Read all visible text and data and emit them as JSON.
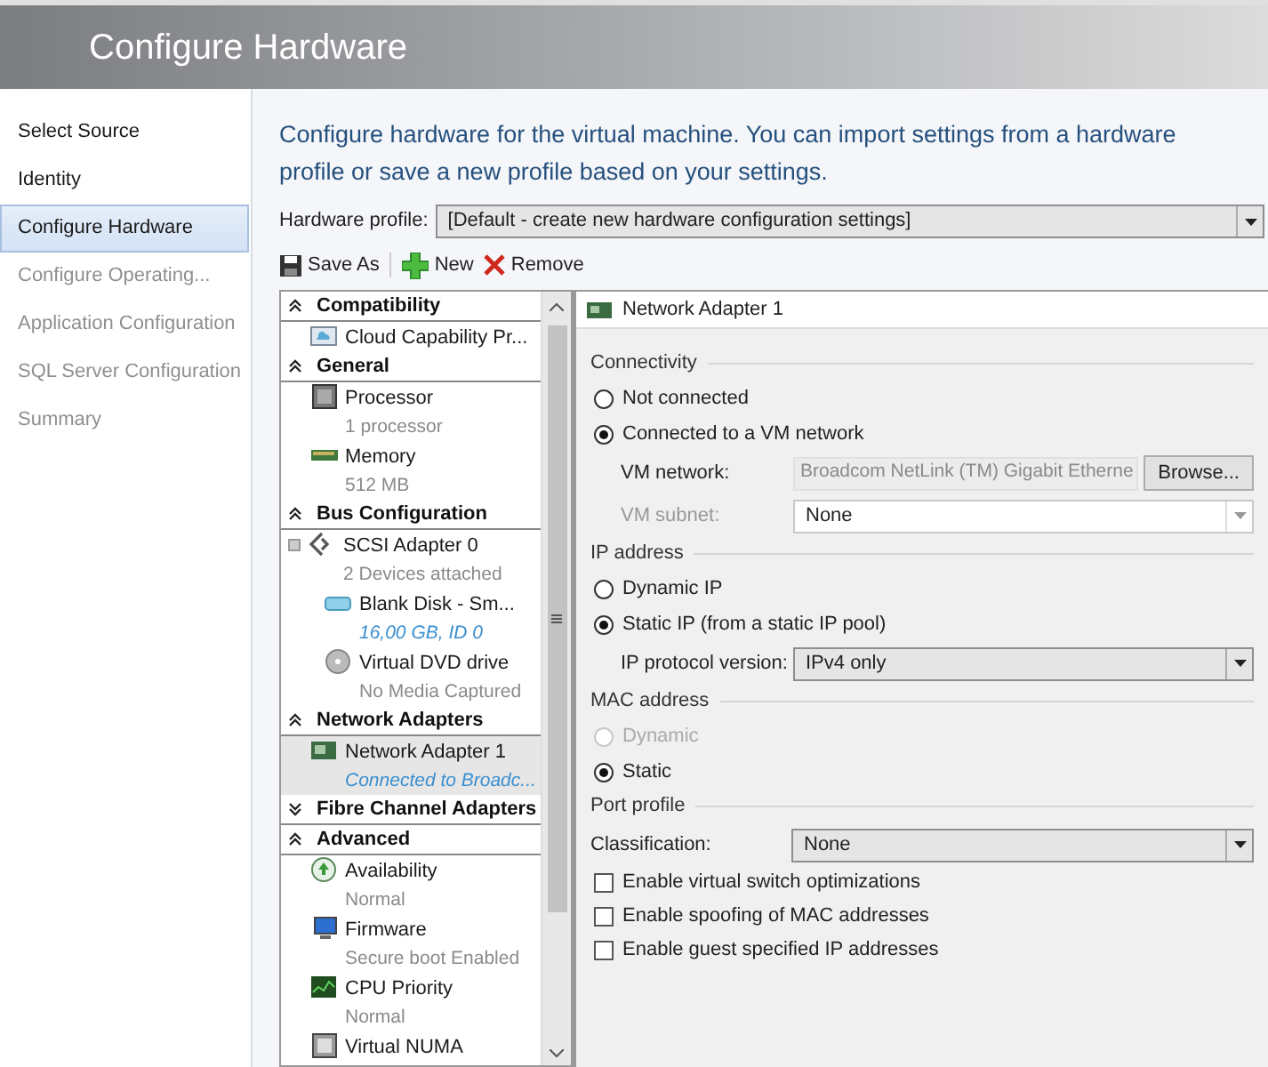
{
  "header": {
    "title": "Configure Hardware"
  },
  "sidebar": {
    "items": [
      {
        "label": "Select Source",
        "selected": false,
        "disabled": false
      },
      {
        "label": "Identity",
        "selected": false,
        "disabled": false
      },
      {
        "label": "Configure Hardware",
        "selected": true,
        "disabled": false
      },
      {
        "label": "Configure Operating...",
        "selected": false,
        "disabled": true
      },
      {
        "label": "Application Configuration",
        "selected": false,
        "disabled": true
      },
      {
        "label": "SQL Server Configuration",
        "selected": false,
        "disabled": true
      },
      {
        "label": "Summary",
        "selected": false,
        "disabled": true
      }
    ]
  },
  "description": "Configure hardware for the virtual machine. You can import settings from a hardware profile or save a new profile based on your settings.",
  "hardware_profile": {
    "label": "Hardware profile:",
    "value": "[Default - create new hardware configuration settings]"
  },
  "toolbar": [
    {
      "label": "Save As",
      "kind": "save"
    },
    {
      "label": "New",
      "kind": "new"
    },
    {
      "label": "Remove",
      "kind": "remove"
    }
  ],
  "tree": {
    "sections": [
      {
        "title": "Compatibility",
        "expanded": true,
        "items": [
          {
            "kind": "cloud",
            "title": "Cloud Capability Pr...",
            "selected": false
          }
        ]
      },
      {
        "title": "General",
        "expanded": true,
        "items": [
          {
            "kind": "processor",
            "title": "Processor",
            "detail": "1 processor",
            "detail_link": false,
            "selected": false
          },
          {
            "kind": "memory",
            "title": "Memory",
            "detail": "512 MB",
            "detail_link": false,
            "selected": false
          }
        ]
      },
      {
        "title": "Bus Configuration",
        "expanded": true,
        "items": [
          {
            "kind": "adapter",
            "title": "SCSI Adapter 0",
            "detail": "2 Devices attached",
            "detail_link": false,
            "selected": false,
            "expanded": true,
            "children": [
              {
                "kind": "disk",
                "title": "Blank Disk - Sm...",
                "detail": "16,00 GB, ID 0",
                "detail_link": true,
                "selected": false
              },
              {
                "kind": "dvd",
                "title": "Virtual DVD drive",
                "detail": "No Media Captured",
                "detail_link": false,
                "selected": false
              }
            ]
          }
        ]
      },
      {
        "title": "Network Adapters",
        "expanded": true,
        "items": [
          {
            "kind": "network",
            "title": "Network Adapter 1",
            "detail": "Connected to Broadc...",
            "detail_link": true,
            "selected": true
          }
        ]
      },
      {
        "title": "Fibre Channel Adapters",
        "expanded": false
      },
      {
        "title": "Advanced",
        "expanded": true,
        "items": [
          {
            "kind": "availability",
            "title": "Availability",
            "detail": "Normal",
            "detail_link": false,
            "selected": false
          },
          {
            "kind": "firmware",
            "title": "Firmware",
            "detail": "Secure boot Enabled",
            "detail_link": false,
            "selected": false
          },
          {
            "kind": "cpu",
            "title": "CPU Priority",
            "detail": "Normal",
            "detail_link": false,
            "selected": false
          },
          {
            "kind": "numa",
            "title": "Virtual NUMA",
            "selected": false
          }
        ]
      }
    ]
  },
  "detail_panel": {
    "title": "Network Adapter 1",
    "groups": [
      {
        "legend": "Connectivity",
        "rows": [
          {
            "kind": "radio",
            "label": "Not connected",
            "selected": false,
            "disabled": false
          },
          {
            "kind": "radio",
            "label": "Connected to a VM network",
            "selected": true,
            "disabled": false
          },
          {
            "kind": "field",
            "label": "VM network:",
            "value": "Broadcom NetLink (TM) Gigabit Etherne",
            "button": "Browse...",
            "disabled": false
          },
          {
            "kind": "select",
            "label": "VM subnet:",
            "value": "None",
            "indented": true,
            "disabled": true
          }
        ]
      },
      {
        "legend": "IP address",
        "rows": [
          {
            "kind": "radio",
            "label": "Dynamic IP",
            "selected": false,
            "disabled": false
          },
          {
            "kind": "radio",
            "label": "Static IP (from a static IP pool)",
            "selected": true,
            "disabled": false
          },
          {
            "kind": "select",
            "label": "IP protocol version:",
            "value": "IPv4 only",
            "indented": true,
            "disabled": false
          }
        ]
      },
      {
        "legend": "MAC address",
        "rows": [
          {
            "kind": "radio",
            "label": "Dynamic",
            "selected": false,
            "disabled": true
          },
          {
            "kind": "radio",
            "label": "Static",
            "selected": true,
            "disabled": false
          }
        ]
      },
      {
        "legend": "Port profile",
        "rows": [
          {
            "kind": "select",
            "label": "Classification:",
            "value": "None",
            "indented": false,
            "disabled": false
          },
          {
            "kind": "checkbox",
            "label": "Enable virtual switch optimizations",
            "checked": false
          },
          {
            "kind": "checkbox",
            "label": "Enable spoofing of MAC addresses",
            "checked": false
          },
          {
            "kind": "checkbox",
            "label": "Enable guest specified IP addresses",
            "checked": false
          }
        ]
      }
    ]
  }
}
